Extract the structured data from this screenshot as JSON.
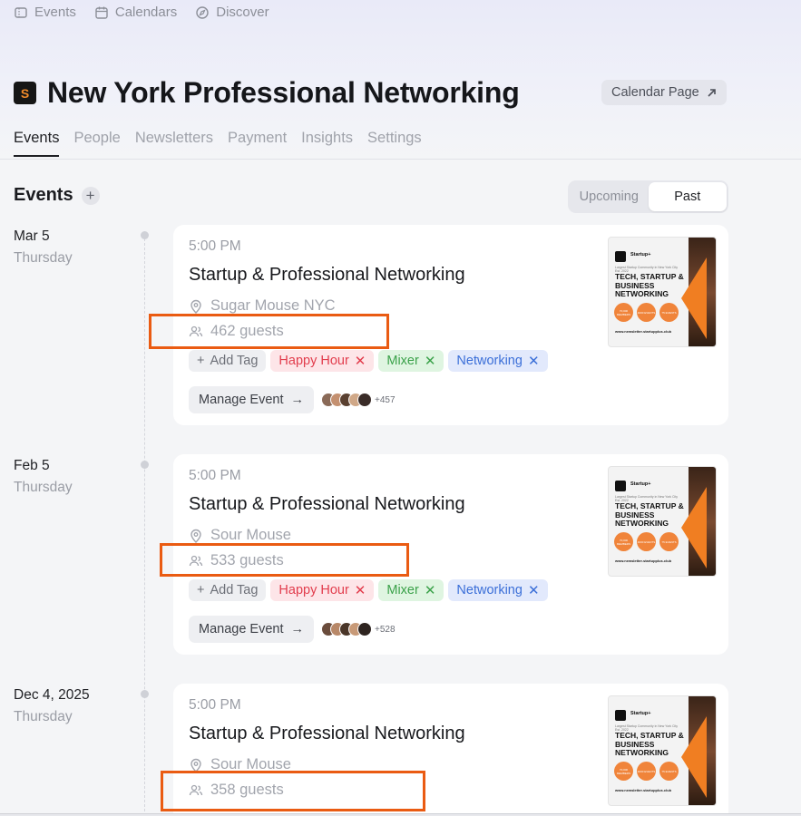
{
  "topnav": [
    {
      "label": "Events",
      "icon": "ticket-icon"
    },
    {
      "label": "Calendars",
      "icon": "calendar-icon"
    },
    {
      "label": "Discover",
      "icon": "compass-icon"
    }
  ],
  "header": {
    "title": "New York Professional Networking",
    "calendar_page_label": "Calendar Page"
  },
  "tabs": [
    "Events",
    "People",
    "Newsletters",
    "Payment",
    "Insights",
    "Settings"
  ],
  "events_section": {
    "title": "Events",
    "toggle": [
      "Upcoming",
      "Past"
    ],
    "active_toggle": "Past"
  },
  "events": [
    {
      "date": "Mar 5",
      "weekday": "Thursday",
      "time": "5:00 PM",
      "title": "Startup & Professional Networking",
      "location": "Sugar Mouse NYC",
      "guests": "462 guests",
      "add_tag": "Add Tag",
      "tags": [
        "Happy Hour",
        "Mixer",
        "Networking"
      ],
      "manage_label": "Manage Event",
      "more_count": "+457"
    },
    {
      "date": "Feb 5",
      "weekday": "Thursday",
      "time": "5:00 PM",
      "title": "Startup & Professional Networking",
      "location": "Sour Mouse",
      "guests": "533 guests",
      "add_tag": "Add Tag",
      "tags": [
        "Happy Hour",
        "Mixer",
        "Networking"
      ],
      "manage_label": "Manage Event",
      "more_count": "+528"
    },
    {
      "date": "Dec 4, 2025",
      "weekday": "Thursday",
      "time": "5:00 PM",
      "title": "Startup & Professional Networking",
      "location": "Sour Mouse",
      "guests": "358 guests"
    }
  ],
  "poster": {
    "brand": "Startup+",
    "subtitle": "Largest Startup Community in New York City Est. 2022",
    "headline": "TECH, STARTUP & BUSINESS NETWORKING",
    "stats": [
      "70,000 MEMBERS",
      "4000 EVENTS",
      "75 EVENTS"
    ],
    "url": "www.newsletter.startupplus.club"
  },
  "colors": {
    "highlight": "#ea5b12",
    "tag_happy": "#e23d4d",
    "tag_mixer": "#3ba24a",
    "tag_networking": "#3b6fd8"
  }
}
